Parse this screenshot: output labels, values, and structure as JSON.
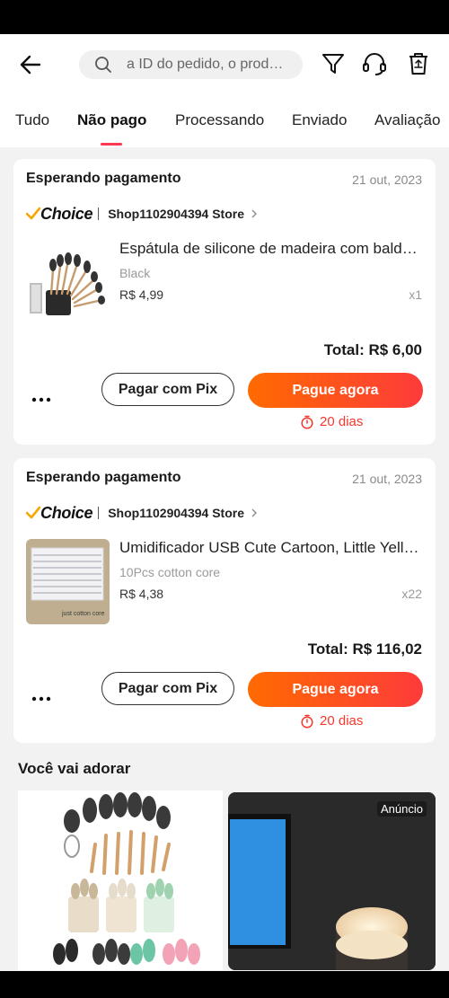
{
  "header": {
    "search_placeholder": "a ID do pedido, o produ..."
  },
  "tabs": [
    {
      "label": "Tudo"
    },
    {
      "label": "Não pago"
    },
    {
      "label": "Processando"
    },
    {
      "label": "Enviado"
    },
    {
      "label": "Avaliação"
    }
  ],
  "orders": [
    {
      "status": "Esperando pagamento",
      "date": "21 out, 2023",
      "brand": "Choice",
      "store": "Shop1102904394 Store",
      "product_title": "Espátula de silicone de madeira com balde de ...",
      "variant": "Black",
      "price": "R$ 4,99",
      "qty": "x1",
      "total": "Total: R$ 6,00",
      "pix_label": "Pagar com Pix",
      "pay_label": "Pague agora",
      "timer": "20 dias"
    },
    {
      "status": "Esperando pagamento",
      "date": "21 out, 2023",
      "brand": "Choice",
      "store": "Shop1102904394 Store",
      "product_title": "Umidificador USB Cute Cartoon, Little Yellow Duck",
      "variant": "10Pcs cotton core",
      "price": "R$ 4,38",
      "qty": "x22",
      "total": "Total: R$ 116,02",
      "pix_label": "Pagar com Pix",
      "pay_label": "Pague agora",
      "timer": "20 dias",
      "thumb_caption": "just cotton core"
    }
  ],
  "recommendations": {
    "title": "Você vai adorar",
    "ad_badge": "Anúncio"
  },
  "icons": {
    "back": "back-arrow-icon",
    "search": "search-icon",
    "filter": "filter-icon",
    "support": "headset-icon",
    "delete": "trash-icon",
    "timer": "stopwatch-icon"
  },
  "colors": {
    "accent": "#fd384f",
    "pay_gradient_start": "#ff6a00",
    "pay_gradient_end": "#fd3b3b",
    "timer_red": "#f5382d",
    "choice_check": "#f7a700"
  }
}
